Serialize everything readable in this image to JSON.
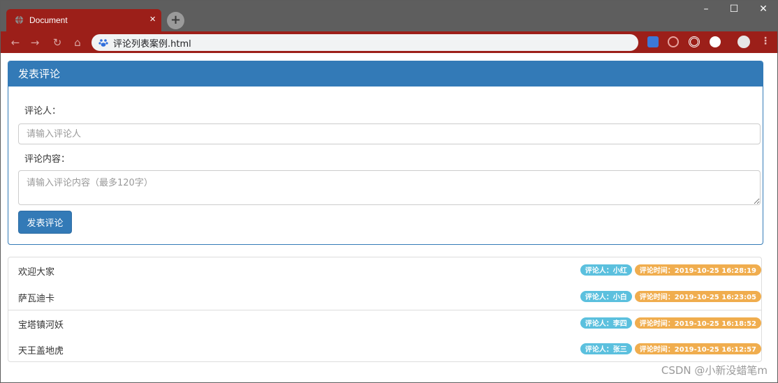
{
  "browser": {
    "tab_title": "Document",
    "address": "评论列表案例.html",
    "window_controls": {
      "minimize": "–",
      "maximize": "☐",
      "close": "✕"
    }
  },
  "form": {
    "heading": "发表评论",
    "commenter_label": "评论人：",
    "commenter_placeholder": "请输入评论人",
    "content_label": "评论内容：",
    "content_placeholder": "请输入评论内容（最多120字）",
    "submit_label": "发表评论"
  },
  "comments": [
    {
      "content": "欢迎大家",
      "user_badge": "评论人：小红",
      "time_badge": "评论时间：2019-10-25 16:28:19"
    },
    {
      "content": "萨瓦迪卡",
      "user_badge": "评论人：小白",
      "time_badge": "评论时间：2019-10-25 16:23:05"
    },
    {
      "content": "宝塔镇河妖",
      "user_badge": "评论人：李四",
      "time_badge": "评论时间：2019-10-25 16:18:52"
    },
    {
      "content": "天王盖地虎",
      "user_badge": "评论人：张三",
      "time_badge": "评论时间：2019-10-25 16:12:57"
    }
  ],
  "watermark": "CSDN @小新没蜡笔m",
  "colors": {
    "primary": "#337ab7",
    "info": "#5bc0de",
    "warning": "#f0ad4e",
    "chrome_red": "#9c1f19"
  }
}
